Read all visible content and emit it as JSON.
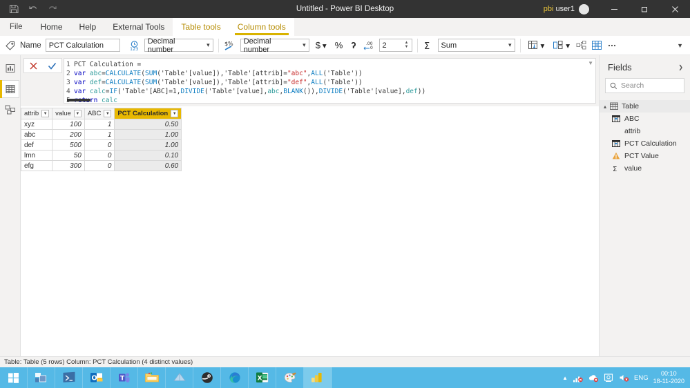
{
  "titlebar": {
    "quick_access": [
      "save-icon",
      "undo-icon",
      "redo-icon"
    ],
    "title": "Untitled - Power BI Desktop",
    "user": "pbi user1",
    "user_prefix": "pbi",
    "user_suffix": " user1",
    "window_buttons": [
      "minimize",
      "restore",
      "close"
    ]
  },
  "ribbon": {
    "tabs": [
      {
        "label": "File",
        "type": "file",
        "active": false
      },
      {
        "label": "Home",
        "type": "normal",
        "active": false
      },
      {
        "label": "Help",
        "type": "normal",
        "active": false
      },
      {
        "label": "External Tools",
        "type": "normal",
        "active": false
      },
      {
        "label": "Table tools",
        "type": "contextual",
        "active": false
      },
      {
        "label": "Column tools",
        "type": "contextual",
        "active": true
      }
    ],
    "structure_group": {
      "icon": "tag-icon",
      "name_label": "Name",
      "name_value": "PCT Calculation",
      "data_type_icon": "datatype-123-icon",
      "data_type_value": "Decimal number"
    },
    "formatting_group": {
      "icon": "format-currency-percent-icon",
      "format_value": "Decimal number",
      "currency_label": "$",
      "percent_label": "%",
      "thousands_label": "ʔ",
      "decimal_icon": "decrease-decimals-icon",
      "decimal_places": "2"
    },
    "properties_group": {
      "sigma_icon": "sigma-icon",
      "summarize_value": "Sum"
    },
    "tools_group": {
      "sort_by_column": "sort-by-column-icon",
      "data_category": "data-category-icon",
      "data_groups": "data-groups-icon",
      "new_column": "new-column-icon",
      "overflow": "more-options-icon"
    },
    "collapse_icon": "chevron-down-icon"
  },
  "left_rail": {
    "items": [
      {
        "name": "report-view",
        "icon": "report-chart-icon",
        "active": false
      },
      {
        "name": "data-view",
        "icon": "data-table-icon",
        "active": true
      },
      {
        "name": "model-view",
        "icon": "model-relationships-icon",
        "active": false
      }
    ]
  },
  "formula_bar": {
    "cancel_icon": "cancel-x-icon",
    "commit_icon": "commit-check-icon",
    "expand_icon": "chevron-down-icon",
    "lines": [
      {
        "n": "1",
        "tokens": [
          {
            "t": "PCT Calculation =",
            "c": "k-num"
          }
        ]
      },
      {
        "n": "2",
        "tokens": [
          {
            "t": "var ",
            "c": "k-kw"
          },
          {
            "t": "abc",
            "c": "k-var"
          },
          {
            "t": "=",
            "c": "k-num"
          },
          {
            "t": "CALCULATE",
            "c": "k-fn"
          },
          {
            "t": "(",
            "c": "k-num"
          },
          {
            "t": "SUM",
            "c": "k-fn"
          },
          {
            "t": "('Table'[value]),'Table'[attrib]=",
            "c": "k-num"
          },
          {
            "t": "\"abc\"",
            "c": "k-str"
          },
          {
            "t": ",",
            "c": "k-num"
          },
          {
            "t": "ALL",
            "c": "k-fn"
          },
          {
            "t": "('Table'))",
            "c": "k-num"
          }
        ]
      },
      {
        "n": "3",
        "tokens": [
          {
            "t": "var ",
            "c": "k-kw"
          },
          {
            "t": "def",
            "c": "k-var"
          },
          {
            "t": "=",
            "c": "k-num"
          },
          {
            "t": "CALCULATE",
            "c": "k-fn"
          },
          {
            "t": "(",
            "c": "k-num"
          },
          {
            "t": "SUM",
            "c": "k-fn"
          },
          {
            "t": "('Table'[value]),'Table'[attrib]=",
            "c": "k-num"
          },
          {
            "t": "\"def\"",
            "c": "k-str"
          },
          {
            "t": ",",
            "c": "k-num"
          },
          {
            "t": "ALL",
            "c": "k-fn"
          },
          {
            "t": "('Table'))",
            "c": "k-num"
          }
        ]
      },
      {
        "n": "4",
        "tokens": [
          {
            "t": "var ",
            "c": "k-kw"
          },
          {
            "t": "calc",
            "c": "k-var"
          },
          {
            "t": "=",
            "c": "k-num"
          },
          {
            "t": "IF",
            "c": "k-fn"
          },
          {
            "t": "('Table'[ABC]=1,",
            "c": "k-num"
          },
          {
            "t": "DIVIDE",
            "c": "k-fn"
          },
          {
            "t": "('Table'[value],",
            "c": "k-num"
          },
          {
            "t": "abc",
            "c": "k-var"
          },
          {
            "t": ",",
            "c": "k-num"
          },
          {
            "t": "BLANK",
            "c": "k-fn"
          },
          {
            "t": "()),",
            "c": "k-num"
          },
          {
            "t": "DIVIDE",
            "c": "k-fn"
          },
          {
            "t": "('Table'[value],",
            "c": "k-num"
          },
          {
            "t": "def",
            "c": "k-var"
          },
          {
            "t": "))",
            "c": "k-num"
          }
        ]
      },
      {
        "n": "5",
        "tokens": [
          {
            "t": "return ",
            "c": "k-kw"
          },
          {
            "t": "calc",
            "c": "k-var"
          }
        ]
      }
    ]
  },
  "grid": {
    "columns": [
      {
        "label": "attrib",
        "selected": false,
        "align": "txt",
        "width": 40
      },
      {
        "label": "value",
        "selected": false,
        "align": "num",
        "width": 42
      },
      {
        "label": "ABC",
        "selected": false,
        "align": "num",
        "width": 38
      },
      {
        "label": "PCT Calculation",
        "selected": true,
        "align": "selcol",
        "width": 88
      }
    ],
    "rows": [
      [
        "xyz",
        "100",
        "1",
        "0.50"
      ],
      [
        "abc",
        "200",
        "1",
        "1.00"
      ],
      [
        "def",
        "500",
        "0",
        "1.00"
      ],
      [
        "lmn",
        "50",
        "0",
        "0.10"
      ],
      [
        "efg",
        "300",
        "0",
        "0.60"
      ]
    ]
  },
  "fields_pane": {
    "title": "Fields",
    "collapse_icon": "chevron-right-icon",
    "search_placeholder": "Search",
    "search_icon": "search-icon",
    "table": {
      "label": "Table",
      "icon": "table-icon",
      "expand_icon": "chevron-up-icon"
    },
    "items": [
      {
        "label": "ABC",
        "icon": "calculated-column-icon"
      },
      {
        "label": "attrib",
        "icon": "none"
      },
      {
        "label": "PCT Calculation",
        "icon": "calculated-column-icon"
      },
      {
        "label": "PCT Value",
        "icon": "error-field-icon"
      },
      {
        "label": "value",
        "icon": "sigma-icon"
      }
    ]
  },
  "statusbar": {
    "text": "Table: Table (5 rows) Column: PCT Calculation (4 distinct values)"
  },
  "taskbar": {
    "items": [
      {
        "name": "start-button",
        "icon": "windows-logo-icon",
        "active": false
      },
      {
        "name": "task-view-button",
        "icon": "task-view-icon",
        "active": false
      },
      {
        "name": "powershell-app",
        "icon": "powershell-icon",
        "active": false
      },
      {
        "name": "outlook-app",
        "icon": "outlook-icon",
        "active": false
      },
      {
        "name": "teams-app",
        "icon": "teams-icon",
        "active": false
      },
      {
        "name": "file-explorer-app",
        "icon": "file-explorer-icon",
        "active": false
      },
      {
        "name": "sticky-notes-app",
        "icon": "sticky-notes-icon",
        "active": false
      },
      {
        "name": "whatsapp-app",
        "icon": "dark-circle-app-icon",
        "active": false
      },
      {
        "name": "edge-app",
        "icon": "edge-icon",
        "active": false
      },
      {
        "name": "excel-app",
        "icon": "excel-icon",
        "active": false
      },
      {
        "name": "paint-app",
        "icon": "paint-icon",
        "active": false
      },
      {
        "name": "power-bi-app",
        "icon": "power-bi-icon",
        "active": true
      }
    ],
    "tray": {
      "overflow_icon": "chevron-up-icon",
      "icons": [
        "network-error-icon",
        "onedrive-error-icon",
        "settings-icon",
        "volume-muted-icon"
      ],
      "language": "ENG",
      "time": "00:10",
      "date": "18-11-2020"
    },
    "colors": {
      "bar": "#55b9e6",
      "active": "#7ccbec"
    }
  },
  "colors": {
    "accent_gold": "#e8b800",
    "titlebar": "#333333",
    "ribbon_bg": "#f3f2f1",
    "selected_header": "#e8b800"
  }
}
